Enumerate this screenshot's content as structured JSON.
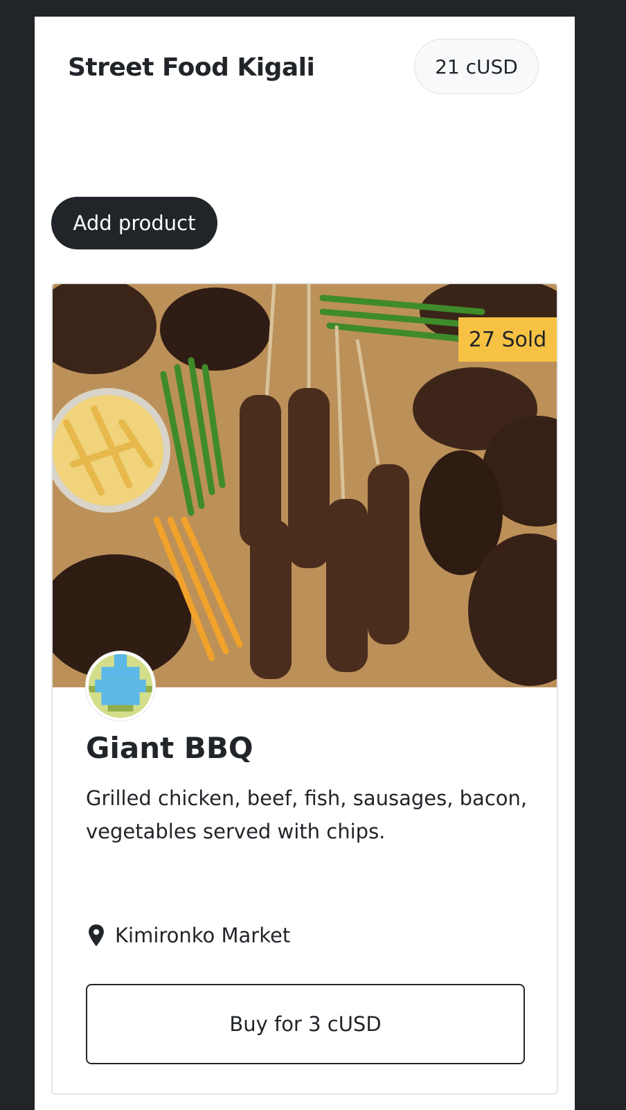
{
  "header": {
    "brand": "Street Food Kigali",
    "balance": "21 cUSD"
  },
  "actions": {
    "add_product_label": "Add product"
  },
  "product": {
    "sold_badge": "27 Sold",
    "name": "Giant BBQ",
    "description": "Grilled chicken, beef, fish, sausages, bacon, vegetables served with chips.",
    "location": "Kimironko Market",
    "buy_label": "Buy for 3 cUSD",
    "image_icon": "bbq-platter-photo",
    "avatar_icon": "identicon-avatar",
    "location_icon": "map-pin-icon"
  },
  "colors": {
    "background": "#212529",
    "surface": "#ffffff",
    "badge": "#f7c244",
    "primary_button": "#212529"
  }
}
